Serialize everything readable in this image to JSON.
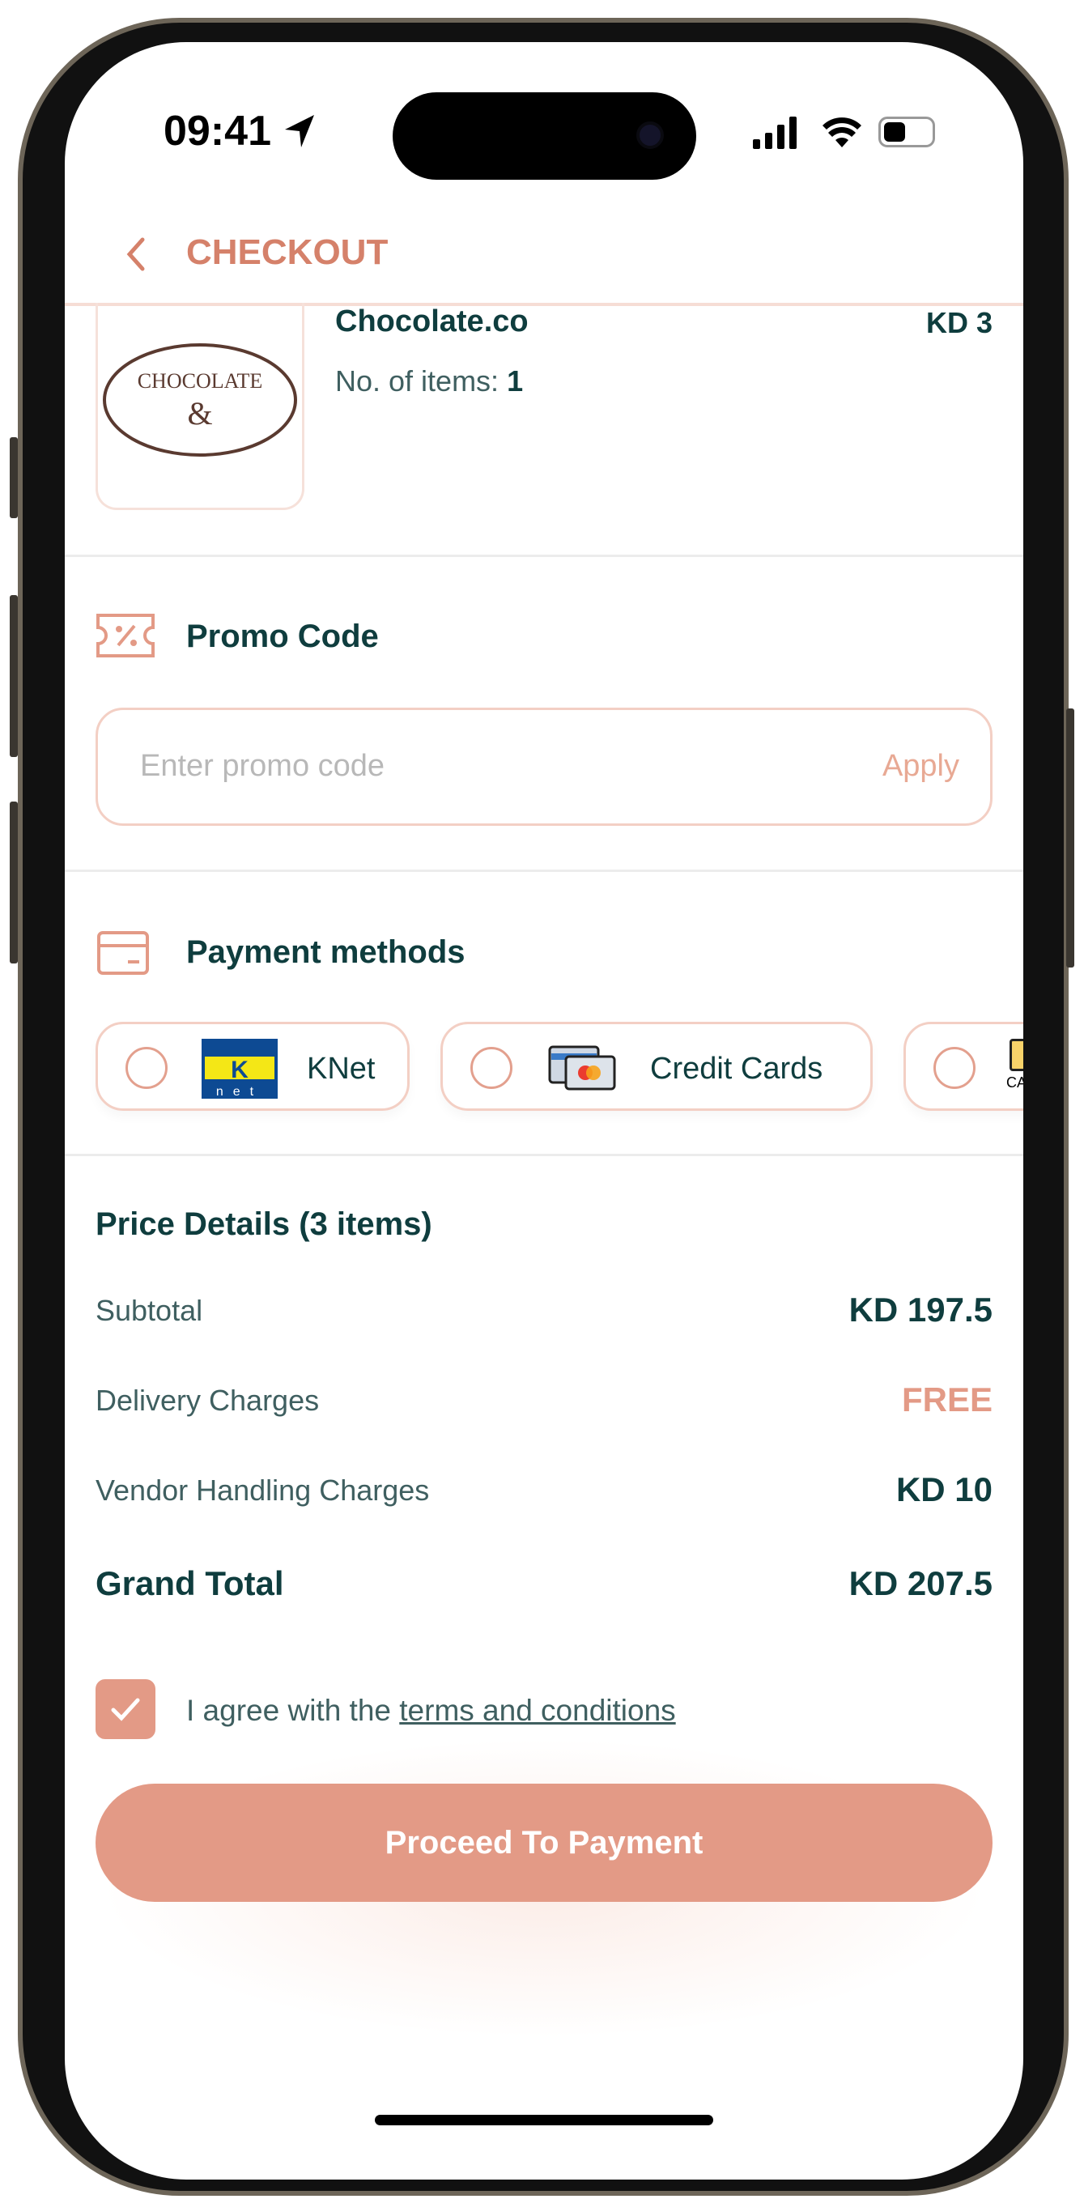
{
  "status_bar": {
    "time": "09:41"
  },
  "header": {
    "title": "CHECKOUT"
  },
  "vendor": {
    "name": "Chocolate.co",
    "price": "KD 3",
    "items_label": "No. of items:",
    "items_count": "1",
    "logo_text": "CHOCOLATE & Co."
  },
  "promo": {
    "title": "Promo Code",
    "placeholder": "Enter promo code",
    "apply": "Apply"
  },
  "payment": {
    "title": "Payment methods",
    "methods": [
      {
        "label": "KNet",
        "selected": false
      },
      {
        "label": "Credit Cards",
        "selected": false
      },
      {
        "label": "CA",
        "selected": false
      }
    ]
  },
  "price": {
    "title": "Price Details (3 items)",
    "rows": [
      {
        "label": "Subtotal",
        "value": "KD 197.5"
      },
      {
        "label": "Delivery Charges",
        "value": "FREE"
      },
      {
        "label": "Vendor Handling Charges",
        "value": "KD 10"
      }
    ],
    "grand_label": "Grand Total",
    "grand_value": "KD 207.5"
  },
  "terms": {
    "checked": true,
    "prefix": "I agree with the ",
    "link": "terms and conditions"
  },
  "cta": {
    "label": "Proceed To Payment"
  },
  "colors": {
    "accent": "#e39a86",
    "teal": "#0f3d3e"
  }
}
